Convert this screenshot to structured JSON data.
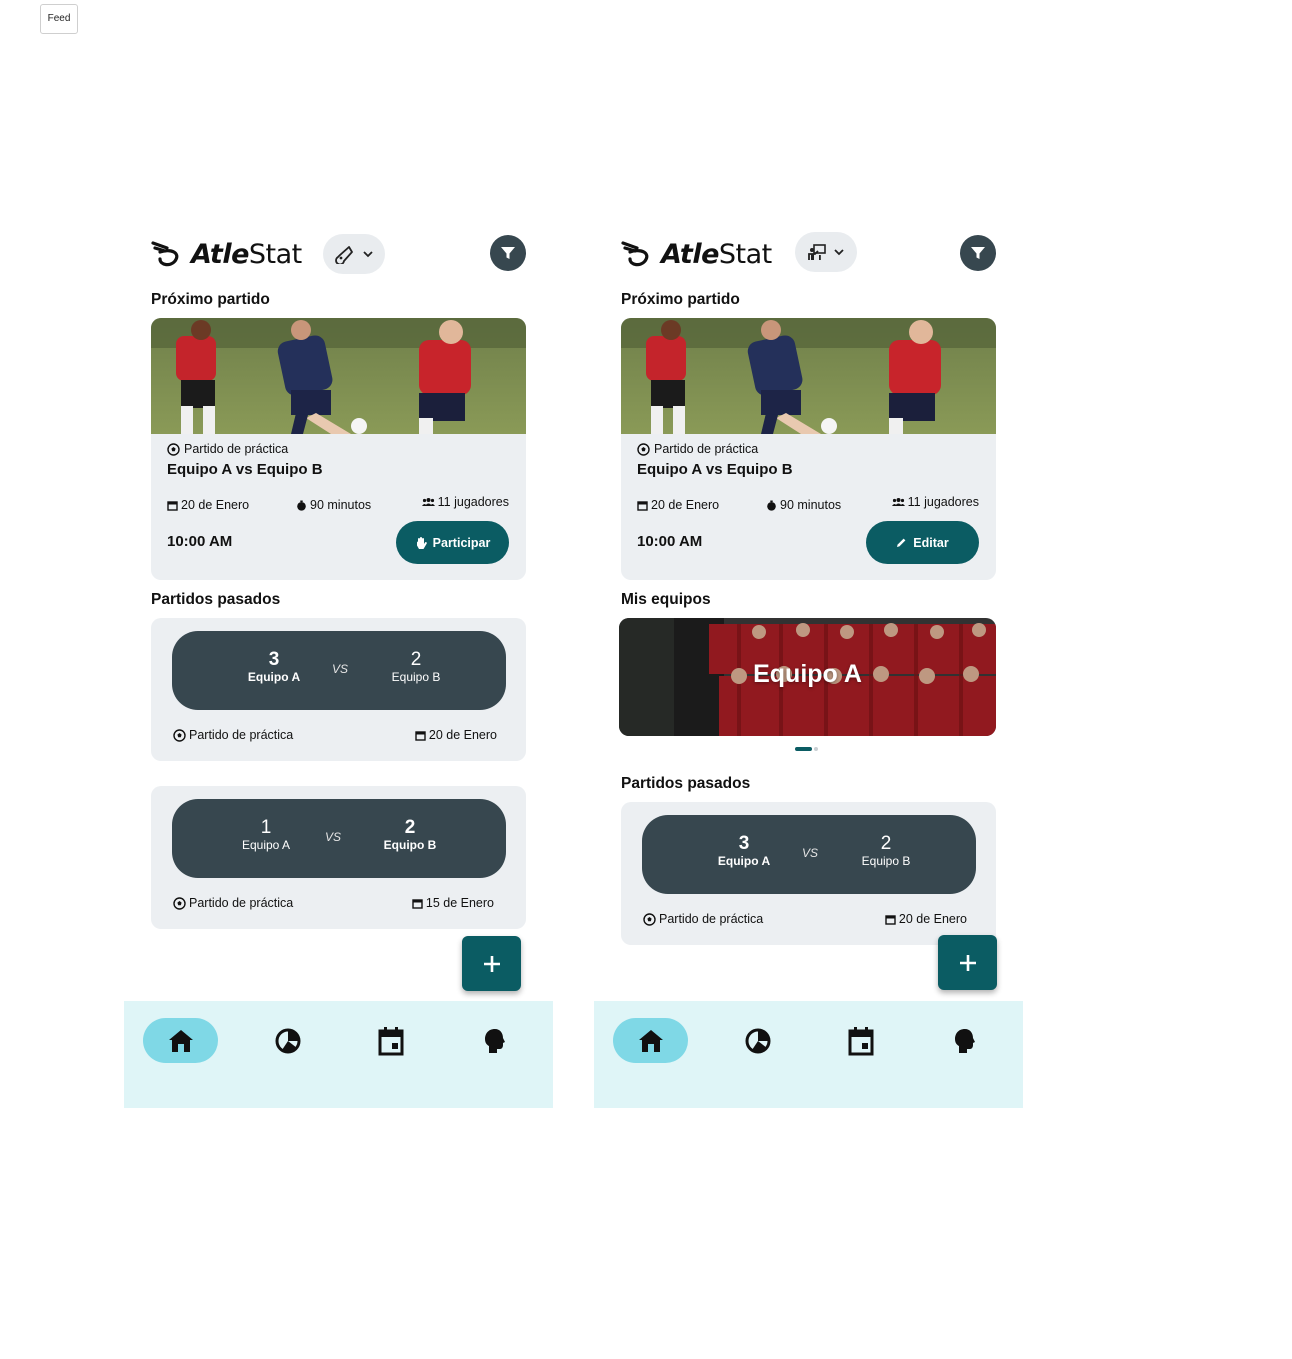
{
  "page": {
    "label": "Feed"
  },
  "colors": {
    "primary": "#0b5c63",
    "dark": "#37474f",
    "card": "#eceff2",
    "nav_bg": "#dff5f7",
    "nav_active": "#7fd8e6"
  },
  "screens": [
    {
      "app": {
        "brand_bold": "Atle",
        "brand_light": "Stat",
        "role_icon": "whistle-icon"
      },
      "next_match": {
        "section_title": "Próximo partido",
        "type": "Partido de práctica",
        "title": "Equipo A vs Equipo B",
        "date": "20 de Enero",
        "duration": "90 minutos",
        "players": "11 jugadores",
        "time": "10:00 AM",
        "action_label": "Participar",
        "action_icon": "hand-icon"
      },
      "past_matches": {
        "section_title": "Partidos pasados",
        "items": [
          {
            "home_score": "3",
            "home_name": "Equipo A",
            "away_score": "2",
            "away_name": "Equipo B",
            "vs": "VS",
            "winner": "home",
            "type": "Partido de práctica",
            "date": "20 de Enero"
          },
          {
            "home_score": "1",
            "home_name": "Equipo A",
            "away_score": "2",
            "away_name": "Equipo B",
            "vs": "VS",
            "winner": "away",
            "type": "Partido de práctica",
            "date": "15 de Enero"
          }
        ]
      },
      "nav": [
        "home-icon",
        "stats-icon",
        "calendar-icon",
        "profile-icon"
      ]
    },
    {
      "app": {
        "brand_bold": "Atle",
        "brand_light": "Stat",
        "role_icon": "coach-board-icon"
      },
      "next_match": {
        "section_title": "Próximo partido",
        "type": "Partido de práctica",
        "title": "Equipo A vs Equipo B",
        "date": "20 de Enero",
        "duration": "90 minutos",
        "players": "11 jugadores",
        "time": "10:00 AM",
        "action_label": "Editar",
        "action_icon": "pencil-icon"
      },
      "my_teams": {
        "section_title": "Mis equipos",
        "items": [
          {
            "name": "Equipo A"
          }
        ]
      },
      "past_matches": {
        "section_title": "Partidos pasados",
        "items": [
          {
            "home_score": "3",
            "home_name": "Equipo A",
            "away_score": "2",
            "away_name": "Equipo B",
            "vs": "VS",
            "winner": "home",
            "type": "Partido de práctica",
            "date": "20 de Enero"
          }
        ]
      },
      "nav": [
        "home-icon",
        "stats-icon",
        "calendar-icon",
        "profile-icon"
      ]
    }
  ]
}
